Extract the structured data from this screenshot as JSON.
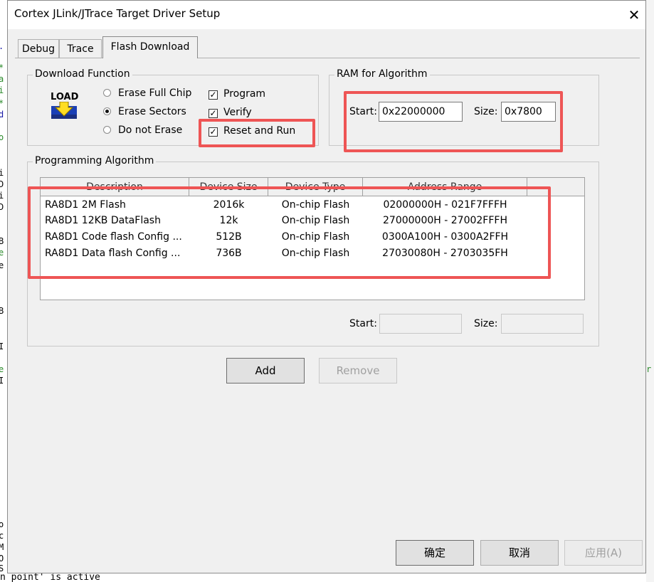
{
  "window": {
    "title": "Cortex JLink/JTrace Target Driver Setup",
    "close_label": "✕"
  },
  "tabs": [
    {
      "label": "Debug"
    },
    {
      "label": "Trace"
    },
    {
      "label": "Flash Download"
    }
  ],
  "download_function": {
    "title": "Download Function",
    "logo_text": "LOAD",
    "erase_options": [
      {
        "label": "Erase Full Chip",
        "selected": false
      },
      {
        "label": "Erase Sectors",
        "selected": true
      },
      {
        "label": "Do not Erase",
        "selected": false
      }
    ],
    "checks": [
      {
        "label": "Program",
        "checked": true
      },
      {
        "label": "Verify",
        "checked": true
      },
      {
        "label": "Reset and Run",
        "checked": true
      }
    ],
    "check_mark": "✓"
  },
  "ram": {
    "title": "RAM for Algorithm",
    "start_label": "Start:",
    "start_value": "0x22000000",
    "size_label": "Size:",
    "size_value": "0x7800"
  },
  "programming_algorithm": {
    "title": "Programming Algorithm",
    "columns": [
      "Description",
      "Device Size",
      "Device Type",
      "Address Range"
    ],
    "rows": [
      {
        "description": "RA8D1 2M Flash",
        "size": "2016k",
        "type": "On-chip Flash",
        "range": "02000000H - 021F7FFFH"
      },
      {
        "description": "RA8D1 12KB DataFlash",
        "size": "12k",
        "type": "On-chip Flash",
        "range": "27000000H - 27002FFFH"
      },
      {
        "description": "RA8D1 Code flash Config ...",
        "size": "512B",
        "type": "On-chip Flash",
        "range": "0300A100H - 0300A2FFH"
      },
      {
        "description": "RA8D1 Data flash Config ...",
        "size": "736B",
        "type": "On-chip Flash",
        "range": "27030080H - 2703035FH"
      }
    ],
    "start_label": "Start:",
    "start_value": "",
    "size_label": "Size:",
    "size_value": ""
  },
  "buttons": {
    "add": "Add",
    "remove": "Remove",
    "ok": "确定",
    "cancel": "取消",
    "apply": "应用(A)"
  },
  "background": {
    "status_text": "n point' is active"
  },
  "colors": {
    "highlight": "#ee5555",
    "dialog_bg": "#f0f0f0"
  }
}
